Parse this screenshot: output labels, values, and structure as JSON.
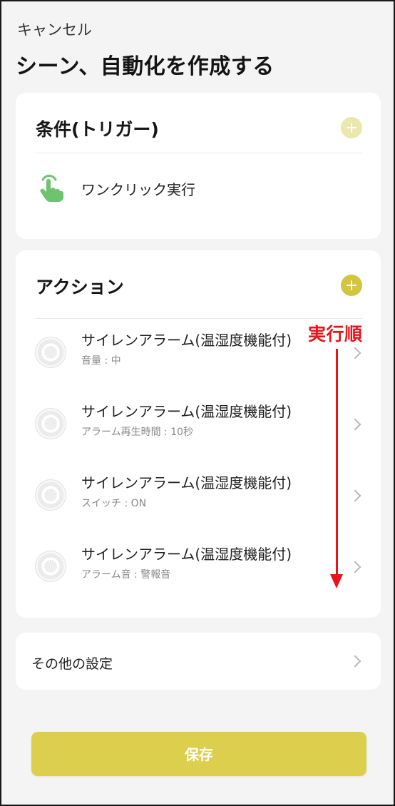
{
  "header": {
    "cancel_label": "キャンセル",
    "title": "シーン、自動化を作成する"
  },
  "trigger_section": {
    "title": "条件(トリガー)",
    "add_button_color": "#ece7ad",
    "item": {
      "label": "ワンクリック実行",
      "icon": "tap-hand-icon",
      "icon_color": "#6cc46f"
    }
  },
  "action_section": {
    "title": "アクション",
    "add_button_color": "#d2c63e",
    "items": [
      {
        "title": "サイレンアラーム(温湿度機能付)",
        "subtitle": "音量 : 中"
      },
      {
        "title": "サイレンアラーム(温湿度機能付)",
        "subtitle": "アラーム再生時間 : 10秒"
      },
      {
        "title": "サイレンアラーム(温湿度機能付)",
        "subtitle": "スイッチ : ON"
      },
      {
        "title": "サイレンアラーム(温湿度機能付)",
        "subtitle": "アラーム音 : 警報音"
      }
    ],
    "annotation": {
      "label": "実行順",
      "color": "#e8141a"
    }
  },
  "other_settings": {
    "label": "その他の設定"
  },
  "save_button": {
    "label": "保存",
    "color": "#dccf4d"
  }
}
